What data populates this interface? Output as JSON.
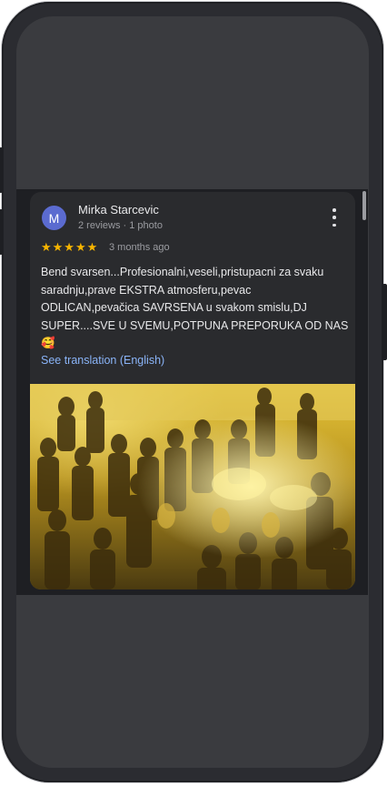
{
  "review": {
    "avatar_initial": "M",
    "reviewer_name": "Mirka Starcevic",
    "reviewer_meta": "2 reviews · 1 photo",
    "rating_stars": "★★★★★",
    "rating_value": 5,
    "date": "3 months ago",
    "text": "Bend svarsen...Profesionalni,veseli,pristupacni za svaku saradnju,prave EKSTRA atmosferu,pevac ODLICAN,pevačica SAVRSENA u svakom smislu,DJ SUPER....SVE U SVEMU,POTPUNA PREPORUKA OD NAS🥰",
    "translation_link": "See translation (English)",
    "more_icon": "more-vert-icon"
  },
  "colors": {
    "avatar_bg": "#5b6bd0",
    "star": "#f7b500",
    "link": "#8ab4f8",
    "card_bg": "#2a2b2e"
  }
}
